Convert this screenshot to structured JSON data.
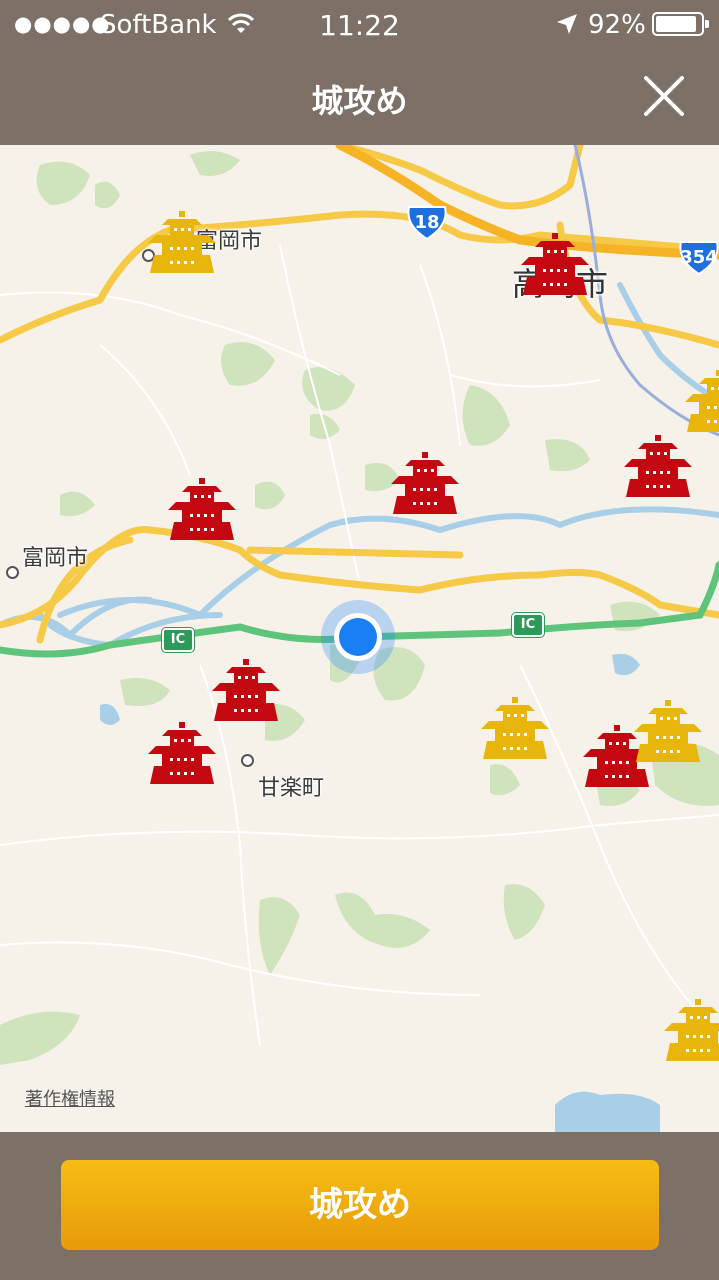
{
  "status_bar": {
    "signal_dots": "●●●●●",
    "carrier": "SoftBank",
    "time": "11:22",
    "battery_percent": "92%",
    "battery_level": 0.92,
    "icons": [
      "wifi-icon",
      "location-arrow-icon",
      "battery-icon"
    ]
  },
  "nav": {
    "title": "城攻め",
    "close_icon": "close-icon"
  },
  "map": {
    "labels": {
      "tomioka_north": "富岡市",
      "takasaki": "高崎市",
      "tomioka": "富岡市",
      "kanra": "甘楽町"
    },
    "routes": [
      "18",
      "354"
    ],
    "ic_labels": [
      "IC",
      "IC"
    ],
    "copyright": "著作権情報",
    "castle_colors": {
      "red": "#c40812",
      "gold": "#e8b60a"
    },
    "castles": [
      {
        "color": "gold"
      },
      {
        "color": "red"
      },
      {
        "color": "gold"
      },
      {
        "color": "red"
      },
      {
        "color": "red"
      },
      {
        "color": "red"
      },
      {
        "color": "red"
      },
      {
        "color": "red"
      },
      {
        "color": "gold"
      },
      {
        "color": "red"
      },
      {
        "color": "gold"
      },
      {
        "color": "gold"
      }
    ],
    "user_location_color": "#1a7ff5"
  },
  "bottom": {
    "attack_button": "城攻め"
  }
}
